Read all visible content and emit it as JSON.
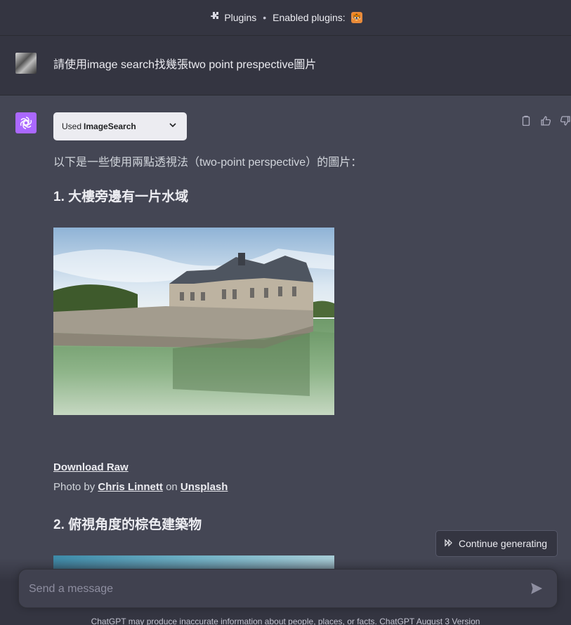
{
  "topbar": {
    "plugins_label": "Plugins",
    "enabled_label": "Enabled plugins:"
  },
  "user": {
    "message": "請使用image search找幾張two point prespective圖片"
  },
  "assistant": {
    "tool_used_prefix": "Used",
    "tool_name": "ImageSearch",
    "intro": "以下是一些使用兩點透視法（two-point perspective）的圖片：",
    "item1_title": "1. 大樓旁邊有一片水域",
    "download_label": "Download Raw",
    "photo_by": "Photo by",
    "photographer": "Chris Linnett",
    "on": "on",
    "source": "Unsplash",
    "item2_title": "2. 俯視角度的棕色建築物"
  },
  "controls": {
    "continue_label": "Continue generating",
    "composer_placeholder": "Send a message"
  },
  "footer": {
    "text": "ChatGPT may produce inaccurate information about people, places, or facts. ChatGPT August 3 Version"
  },
  "colors": {
    "background": "#444654",
    "header": "#343541",
    "accent_gpt": "#ab68ff"
  }
}
